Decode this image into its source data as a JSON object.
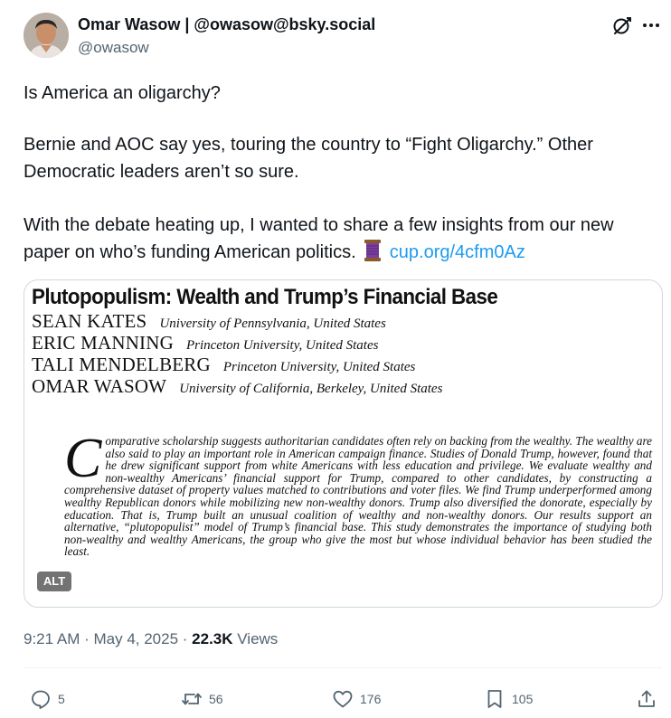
{
  "author": {
    "name": "Omar Wasow | @owasow@bsky.social",
    "handle": "@owasow"
  },
  "post": {
    "line1": "Is America an oligarchy?",
    "line2a": "Bernie and AOC say yes, touring the country to “Fight Oligarchy.” Other",
    "line2b": "Democratic leaders aren’t so sure.",
    "line3a": "With the debate heating up, I wanted to share a few insights from our new",
    "line3b": "paper on who’s funding American politics.",
    "link": "cup.org/4cfm0Az"
  },
  "media": {
    "title": "Plutopopulism: Wealth and Trump’s Financial Base",
    "authors": [
      {
        "name": "SEAN KATES",
        "affiliation": "University of Pennsylvania, United States"
      },
      {
        "name": "ERIC MANNING",
        "affiliation": "Princeton University, United States"
      },
      {
        "name": "TALI MENDELBERG",
        "affiliation": "Princeton University, United States"
      },
      {
        "name": "OMAR WASOW",
        "affiliation": "University of California, Berkeley, United States"
      }
    ],
    "abstract_dropcap": "C",
    "abstract_text": "omparative scholarship suggests authoritarian candidates often rely on backing from the wealthy. The wealthy are also said to play an important role in American campaign finance. Studies of Donald Trump, however, found that he drew significant support from white Americans with less education and privilege. We evaluate wealthy and non-wealthy Americans’ financial support for Trump, compared to other candidates, by constructing a comprehensive dataset of property values matched to contributions and voter files. We find Trump underperformed among wealthy Republican donors while mobilizing new non-wealthy donors. Trump also diversified the donorate, especially by education. That is, Trump built an unusual coalition of wealthy and non-wealthy donors. Our results support an alternative, “plutopopulist” model of Trump’s financial base. This study demonstrates the importance of studying both non-wealthy and wealthy Americans, the group who give the most but whose individual behavior has been studied the least.",
    "alt_badge": "ALT"
  },
  "meta": {
    "time": "9:21 AM",
    "sep1": " · ",
    "date": "May 4, 2025",
    "sep2": " · ",
    "views_count": "22.3K",
    "views_label": " Views"
  },
  "actions": {
    "replies": "5",
    "reposts": "56",
    "likes": "176",
    "bookmarks": "105"
  },
  "colors": {
    "accent": "#1d9bf0",
    "secondary_text": "#536471",
    "primary_text": "#0f1419"
  }
}
